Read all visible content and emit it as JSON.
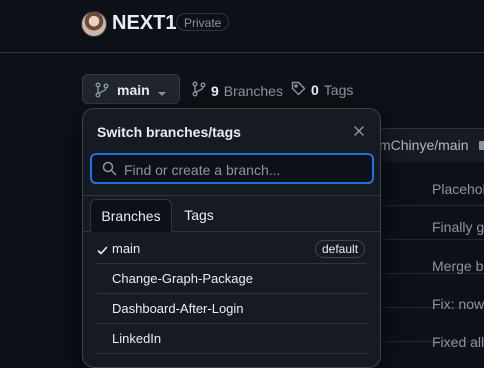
{
  "repo": {
    "name": "NEXT1",
    "visibility": "Private"
  },
  "branch_button": {
    "label": "main"
  },
  "meta": {
    "branches_count": "9",
    "branches_label": "Branches",
    "tags_count": "0",
    "tags_label": "Tags"
  },
  "background": {
    "commit_ref": "mChinye/main",
    "row_texts": [
      "Placehol",
      "Finally g",
      "Merge b",
      "Fix: now",
      "Fixed all"
    ]
  },
  "popover": {
    "title": "Switch branches/tags",
    "search_placeholder": "Find or create a branch...",
    "tabs": [
      "Branches",
      "Tags"
    ],
    "items": [
      {
        "name": "main",
        "selected": true,
        "badge": "default"
      },
      {
        "name": "Change-Graph-Package"
      },
      {
        "name": "Dashboard-After-Login"
      },
      {
        "name": "LinkedIn"
      }
    ]
  },
  "colors": {
    "accent": "#1f6feb",
    "bg": "#0d1117",
    "panel": "#161b22",
    "muted": "#8b949e"
  }
}
